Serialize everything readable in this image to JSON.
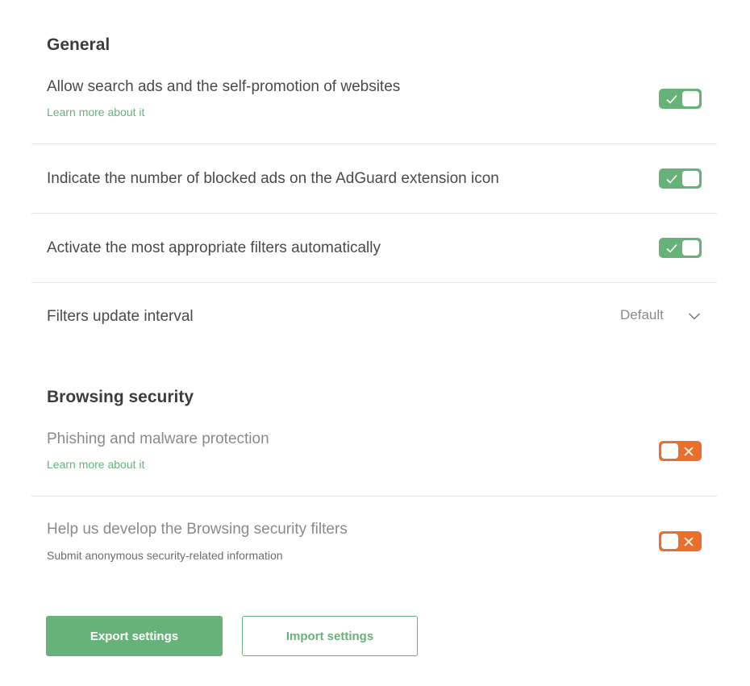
{
  "general": {
    "title": "General",
    "items": [
      {
        "label": "Allow search ads and the self-promotion of websites",
        "link": "Learn more about it",
        "enabled": true
      },
      {
        "label": "Indicate the number of blocked ads on the AdGuard extension icon",
        "enabled": true
      },
      {
        "label": "Activate the most appropriate filters automatically",
        "enabled": true
      }
    ],
    "update_interval": {
      "label": "Filters update interval",
      "value": "Default"
    }
  },
  "browsing_security": {
    "title": "Browsing security",
    "items": [
      {
        "label": "Phishing and malware protection",
        "link": "Learn more about it",
        "enabled": false
      },
      {
        "label": "Help us develop the Browsing security filters",
        "description": "Submit anonymous security-related information",
        "enabled": false
      }
    ]
  },
  "buttons": {
    "export": "Export settings",
    "import": "Import settings"
  },
  "colors": {
    "accent": "#67b279",
    "off": "#eb6f2c"
  }
}
